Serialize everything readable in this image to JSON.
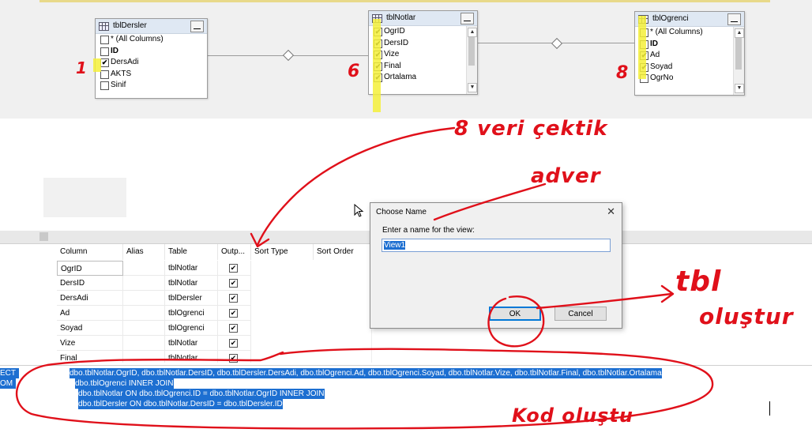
{
  "diagram": {
    "tables": [
      {
        "name": "tblDersler",
        "fields": [
          {
            "label": "* (All Columns)",
            "checked": false,
            "key": false
          },
          {
            "label": "ID",
            "checked": false,
            "key": true
          },
          {
            "label": "DersAdi",
            "checked": true,
            "key": false
          },
          {
            "label": "AKTS",
            "checked": false,
            "key": false
          },
          {
            "label": "Sinif",
            "checked": false,
            "key": false
          }
        ]
      },
      {
        "name": "tblNotlar",
        "fields": [
          {
            "label": "OgrID",
            "checked": true,
            "key": false
          },
          {
            "label": "DersID",
            "checked": true,
            "key": false
          },
          {
            "label": "Vize",
            "checked": true,
            "key": false
          },
          {
            "label": "Final",
            "checked": true,
            "key": false
          },
          {
            "label": "Ortalama",
            "checked": true,
            "key": false
          }
        ]
      },
      {
        "name": "tblOgrenci",
        "fields": [
          {
            "label": "* (All Columns)",
            "checked": false,
            "key": false
          },
          {
            "label": "ID",
            "checked": false,
            "key": true
          },
          {
            "label": "Ad",
            "checked": true,
            "key": false
          },
          {
            "label": "Soyad",
            "checked": true,
            "key": false
          },
          {
            "label": "OgrNo",
            "checked": false,
            "key": false
          }
        ]
      }
    ],
    "check_glyph": "✔"
  },
  "criteria_grid": {
    "headers": [
      "Column",
      "Alias",
      "Table",
      "Outp...",
      "Sort Type",
      "Sort Order"
    ],
    "rows": [
      {
        "column": "OgrID",
        "alias": "",
        "table": "tblNotlar",
        "output": true
      },
      {
        "column": "DersID",
        "alias": "",
        "table": "tblNotlar",
        "output": true
      },
      {
        "column": "DersAdi",
        "alias": "",
        "table": "tblDersler",
        "output": true
      },
      {
        "column": "Ad",
        "alias": "",
        "table": "tblOgrenci",
        "output": true
      },
      {
        "column": "Soyad",
        "alias": "",
        "table": "tblOgrenci",
        "output": true
      },
      {
        "column": "Vize",
        "alias": "",
        "table": "tblNotlar",
        "output": true
      },
      {
        "column": "Final",
        "alias": "",
        "table": "tblNotlar",
        "output": true
      }
    ]
  },
  "sql_pane": {
    "kw_select": "ECT",
    "kw_from": "OM",
    "lines": [
      "dbo.tblNotlar.OgrID, dbo.tblNotlar.DersID, dbo.tblDersler.DersAdi, dbo.tblOgrenci.Ad, dbo.tblOgrenci.Soyad, dbo.tblNotlar.Vize, dbo.tblNotlar.Final, dbo.tblNotlar.Ortalama",
      "dbo.tblOgrenci INNER JOIN",
      "dbo.tblNotlar ON dbo.tblOgrenci.ID = dbo.tblNotlar.OgrID INNER JOIN",
      "dbo.tblDersler ON dbo.tblNotlar.DersID = dbo.tblDersler.ID"
    ]
  },
  "dialog": {
    "title": "Choose Name",
    "close_glyph": "✕",
    "prompt": "Enter a name for the view:",
    "input_value": "View1",
    "ok_label": "OK",
    "cancel_label": "Cancel"
  },
  "annotations": {
    "count_dersler": "1",
    "count_notlar": "6",
    "count_ogrenci": "8",
    "note_columns": "8 veri çektik",
    "note_name": "adver",
    "note_ok_1": "tbl",
    "note_ok_2": "oluştur",
    "note_sql": "Kod oluştu"
  },
  "colors": {
    "highlight": "#f5f03a",
    "ink": "#e0101a",
    "selection": "#1d6fd1"
  }
}
